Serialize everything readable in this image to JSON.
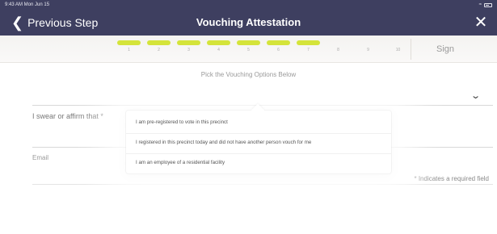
{
  "status_bar": {
    "time_date": "9:43 AM  Mon Jun 15"
  },
  "nav": {
    "back_label": "Previous Step",
    "back_icon": "chevron-left-icon",
    "title": "Vouching Attestation",
    "close_icon": "close-icon",
    "bar_color": "#3e3f60"
  },
  "steps": {
    "items": [
      {
        "num": "1",
        "done": true
      },
      {
        "num": "2",
        "done": true
      },
      {
        "num": "3",
        "done": true
      },
      {
        "num": "4",
        "done": true
      },
      {
        "num": "5",
        "done": true
      },
      {
        "num": "6",
        "done": true
      },
      {
        "num": "7",
        "done": true
      },
      {
        "num": "8",
        "done": false
      },
      {
        "num": "9",
        "done": false
      },
      {
        "num": "10",
        "done": false
      }
    ],
    "done_color": "#d4e43a",
    "sign_label": "Sign"
  },
  "form": {
    "subtitle": "Pick the Vouching Options Below",
    "swear_label": "I swear or affirm that *",
    "email_label": "Email",
    "required_note": "* Indicates a required field",
    "select_icon": "chevron-down-icon"
  },
  "dropdown": {
    "options": [
      "I am pre-registered to vote in this precinct",
      "I registered in this precinct today and did not have another person vouch for me",
      "I am an employee of a residential facility"
    ]
  }
}
